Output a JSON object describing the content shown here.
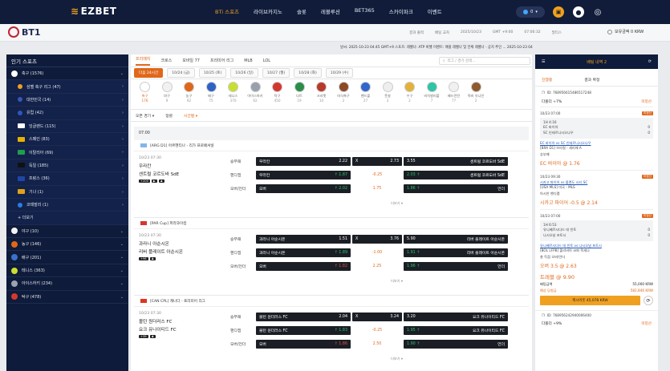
{
  "brand": "EZBET",
  "nav": [
    "BTi 스포츠",
    "라이브카지노",
    "슬롯",
    "레볼루션",
    "BET365",
    "스카이파크",
    "이벤트"
  ],
  "nav_new": "NEW",
  "coin": "0",
  "bt1": "BT1",
  "subinfo": [
    "결과 출력",
    "배팅 교차",
    "2025/10/23",
    "GMT +9:00",
    "07:06:32",
    "멀티스"
  ],
  "balance": "보유금액 0 KRW",
  "notice": "날씨: 2025-10-23 04:45 GMT+9 스포츠: 레벨나: ATP 바젤 이벤트: 애플 레벨나 및 전체 레벨나 - 공지 추인 ... 2025-10-23 04:48 GMT+9 스포츠 배팅...",
  "sidebar": {
    "title": "인기 스포츠",
    "items": [
      {
        "label": "축구 (1576)",
        "type": "sport",
        "color": "#ffffff"
      },
      {
        "label": "삼벨 축구 리그 (47)",
        "type": "sub",
        "color": "#f0a020"
      },
      {
        "label": "대한민국 (14)",
        "type": "sub",
        "color": "#3457b8"
      },
      {
        "label": "유럽 (42)",
        "type": "sub",
        "color": "#2f55c0"
      },
      {
        "label": "잉글랜드 (115)",
        "type": "subflag",
        "color": "#ffffff"
      },
      {
        "label": "스페인 (83)",
        "type": "subflag",
        "color": "#e8b100"
      },
      {
        "label": "이탈리아 (69)",
        "type": "subflag",
        "color": "#1e9e4f"
      },
      {
        "label": "독일 (185)",
        "type": "subflag",
        "color": "#111111"
      },
      {
        "label": "프랑스 (36)",
        "type": "subflag",
        "color": "#2146a8"
      },
      {
        "label": "기나 (1)",
        "type": "subflag",
        "color": "#e0a21a"
      },
      {
        "label": "코테발리 (1)",
        "type": "sub",
        "color": "#2c7be5"
      },
      {
        "label": "+ 더보기",
        "type": "more",
        "color": ""
      },
      {
        "label": "야구 (10)",
        "type": "sport",
        "color": "#f3f3f3"
      },
      {
        "label": "농구 (146)",
        "type": "sport",
        "color": "#e0671a"
      },
      {
        "label": "배구 (201)",
        "type": "sport",
        "color": "#3a71c9"
      },
      {
        "label": "테니스 (363)",
        "type": "sport",
        "color": "#c9de2f"
      },
      {
        "label": "아이스하키 (234)",
        "type": "sport",
        "color": "#9aa3b2"
      },
      {
        "label": "탁구 (478)",
        "type": "sport",
        "color": "#d3382f"
      }
    ]
  },
  "tabs": [
    "프리매치",
    "크로스",
    "모바일 77",
    "프리미어 리그",
    "MLB",
    "LOL"
  ],
  "search_placeholder": "리그 / 경기 검색...",
  "dates": [
    "다음 24시간",
    "10/24 (금)",
    "10/25 (토)",
    "10/26 (일)",
    "10/27 (월)",
    "10/28 (화)",
    "10/29 (수)"
  ],
  "sports": [
    {
      "name": "축구",
      "count": "176",
      "color": "#ffffff"
    },
    {
      "name": "야구",
      "count": "9",
      "color": "#f1f1f1"
    },
    {
      "name": "농구",
      "count": "92",
      "color": "#e0671a"
    },
    {
      "name": "배구",
      "count": "75",
      "color": "#2f62c5"
    },
    {
      "name": "테니스",
      "count": "370",
      "color": "#c9de2f"
    },
    {
      "name": "아이스하키",
      "count": "62",
      "color": "#98a0ae"
    },
    {
      "name": "탁구",
      "count": "450",
      "color": "#d3382f"
    },
    {
      "name": "다트",
      "count": "19",
      "color": "#2c8d49"
    },
    {
      "name": "크리켓",
      "count": "10",
      "color": "#b83a2a"
    },
    {
      "name": "미식축구",
      "count": "2",
      "color": "#8b4a25"
    },
    {
      "name": "핸드볼",
      "count": "27",
      "color": "#3366cc"
    },
    {
      "name": "풋살",
      "count": "3",
      "color": "#eeeeee"
    },
    {
      "name": "수구",
      "count": "2",
      "color": "#e2b23a"
    },
    {
      "name": "비치발리볼",
      "count": "7",
      "color": "#2ec4a5"
    },
    {
      "name": "배드민턴",
      "count": "77",
      "color": "#f0f0f0"
    },
    {
      "name": "럭비 유니언",
      "count": "2",
      "color": "#8f5a2e"
    }
  ],
  "filters": [
    "오픈 경기 ▾",
    "정렬",
    "시간별 ▾"
  ],
  "time_header": "07:00",
  "games": [
    {
      "league": "[ARG D1] 아르헨티나 - 리가 프로페셔널",
      "flag": "#7fb8e8",
      "time": "10/23 07:30",
      "home": "우라칸",
      "away": "센트럴 코르도바 SdE",
      "tags": [
        "+200",
        "▶",
        "♟"
      ],
      "ml": {
        "label": "승무패",
        "home": "우라칸",
        "h": "2.22",
        "x": "X",
        "xo": "2.73",
        "away": "센트럴 코르도바 SdE",
        "a": "3.55"
      },
      "hc": {
        "label": "핸디캡",
        "home": "우라칸",
        "h": "↑ 1.87",
        "line": "-0.25",
        "away": "센트럴 코르도바 SdE",
        "a": "2.03 ↑"
      },
      "ou": {
        "label": "오버/언더",
        "o": "오버",
        "ov": "↑ 2.02",
        "line": "1.75",
        "u": "언더",
        "uv": "1.86 ↑"
      },
      "more": "더보기 ▾"
    },
    {
      "league": "[PAR Cup] 파라과이컵",
      "flag": "#d3382f",
      "time": "10/23 07:30",
      "home": "과라니 아순시온",
      "away": "리버 플레이트 아순시온",
      "tags": [
        "+96",
        "♟"
      ],
      "ml": {
        "label": "승무패",
        "home": "과라니 아순시온",
        "h": "1.51",
        "x": "X",
        "xo": "3.76",
        "away": "리버 플레이트 아순시온",
        "a": "5.90"
      },
      "hc": {
        "label": "핸디캡",
        "home": "과라니 아순시온",
        "h": "↑ 1.89",
        "line": "-1.00",
        "away": "리버 플레이트 아순시온",
        "a": "1.91 ↑"
      },
      "ou": {
        "label": "오버/언더",
        "o": "오버",
        "ov": "↑ 1.82",
        "line": "2.25",
        "u": "언더",
        "uv": "1.96 ↑"
      },
      "more": "더보기 ▾"
    },
    {
      "league": "[CAN CPL] 캐나다 - 프리미어 리그",
      "flag": "#e0341f",
      "time": "10/23 07:30",
      "home": "볼턴 원더러스 FC",
      "away": "요크 유나이티드 FC",
      "tags": [
        "+39",
        "♟"
      ],
      "ml": {
        "label": "승무패",
        "home": "볼턴 원더러스 FC",
        "h": "2.04",
        "x": "X",
        "xo": "3.24",
        "away": "요크 유나이티드 FC",
        "a": "3.20"
      },
      "hc": {
        "label": "핸디캡",
        "home": "볼턴 원더러스 FC",
        "h": "↑ 1.83",
        "line": "-0.25",
        "away": "요크 유나이티드 FC",
        "a": "1.95 ↑"
      },
      "ou": {
        "label": "오버/언더",
        "o": "오버",
        "ov": "↑ 1.86",
        "line": "2.50",
        "u": "언더",
        "uv": "1.90 ↑"
      },
      "more": "더보기 ▾"
    }
  ],
  "slip": {
    "head_left": "☰",
    "head_mid": "배팅 내역",
    "head_count": "2",
    "head_right": "⟳",
    "tabs": [
      "진행중",
      "결과 확정"
    ],
    "ticket1_id": "ID: 768956615486517248",
    "ticket1_title": "다폴더 +7%",
    "ticket1_status": "미정산",
    "bets": [
      {
        "time": "10/23 07:00",
        "status": "미정산",
        "score_top": "1H 4:16",
        "s1n": "EC 바이아",
        "s1": "0",
        "s2n": "SC 인테르나시오나우",
        "s2": "0",
        "match": "EC 바이아 vs SC 인테르나시오나우",
        "league": "[BRA D1] 브라질 - 세리에 A",
        "market": "승부패",
        "pick": "EC 바이아 @ 1.76"
      },
      {
        "time": "10/23 09:30",
        "status": "미정산",
        "match": "시카고 파이어 vs 올랜도 시티 SC",
        "league": "[USA MLS] 미국 - MLS",
        "market": "아시안 핸디캡",
        "pick": "시카고 파이어 -0.5 @ 2.14"
      },
      {
        "time": "10/23 07:00",
        "status": "미정산",
        "score_top": "1H 6:53",
        "s1n": "유니베르시다드 데 빈토",
        "s1": "0",
        "s2n": "나시오날 포토시",
        "s2": "0",
        "match": "유니베르시다드 데 빈토 vs 나시오날 포토시",
        "league": "[BOL LFPB] 볼리비아 코파 목세나",
        "market": "총 득점 오버/언더",
        "pick": "오버 3.5 @ 2.63"
      }
    ],
    "total_label": "트레블 @ 9.90",
    "stake_label": "배팅금액",
    "stake": "55,000 KRW",
    "win_label": "예상 당첨금",
    "win": "582,846 KRW",
    "cashout": "캐시아웃 45,078 KRW",
    "refresh": "⟳",
    "ticket2_id": "ID: 768956242940006400",
    "ticket2_title": "다폴더 +9%",
    "ticket2_status": "미정산"
  }
}
